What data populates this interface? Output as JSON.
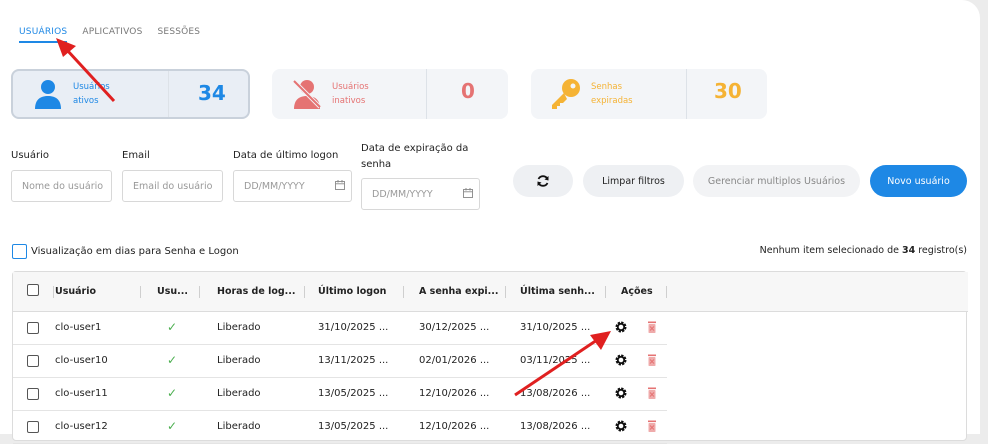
{
  "tabs": [
    {
      "label": "USUÁRIOS",
      "active": true
    },
    {
      "label": "APLICATIVOS",
      "active": false
    },
    {
      "label": "SESSÕES",
      "active": false
    }
  ],
  "cards": [
    {
      "label_line1": "Usuários",
      "label_line2": "ativos",
      "count": "34",
      "color": "#1e88e5",
      "icon": "user-icon"
    },
    {
      "label_line1": "Usuários",
      "label_line2": "inativos",
      "count": "0",
      "color": "#e57373",
      "icon": "user-off-icon"
    },
    {
      "label_line1": "Senhas",
      "label_line2": "expiradas",
      "count": "30",
      "color": "#f5b335",
      "icon": "key-icon"
    }
  ],
  "filters": {
    "user_label": "Usuário",
    "user_placeholder": "Nome do usuário",
    "email_label": "Email",
    "email_placeholder": "Email do usuário",
    "last_logon_label": "Data de último logon",
    "last_logon_placeholder": "DD/MM/YYYY",
    "expiry_label_line1": "Data de expiração da",
    "expiry_label_line2": "senha",
    "expiry_placeholder": "DD/MM/YYYY"
  },
  "buttons": {
    "clear": "Limpar filtros",
    "manage": "Gerenciar multiplos Usuários",
    "new_user": "Novo usuário"
  },
  "view_days_label": "Visualização em dias para Senha e Logon",
  "selection": {
    "prefix": "Nenhum item selecionado de ",
    "count": "34",
    "suffix": " registro(s)"
  },
  "table": {
    "headers": [
      "Usuário",
      "Usu...",
      "Horas de log...",
      "Último logon",
      "A senha expi...",
      "Última senh...",
      "Ações"
    ],
    "rows": [
      {
        "user": "clo-user1",
        "status": "✓",
        "hours": "Liberado",
        "last_logon": "31/10/2025 ...",
        "expires": "30/12/2025 ...",
        "last_change": "31/10/2025 ..."
      },
      {
        "user": "clo-user10",
        "status": "✓",
        "hours": "Liberado",
        "last_logon": "13/11/2025 ...",
        "expires": "02/01/2026 ...",
        "last_change": "03/11/2025 ..."
      },
      {
        "user": "clo-user11",
        "status": "✓",
        "hours": "Liberado",
        "last_logon": "13/05/2025 ...",
        "expires": "12/10/2026 ...",
        "last_change": "13/08/2026 ..."
      },
      {
        "user": "clo-user12",
        "status": "✓",
        "hours": "Liberado",
        "last_logon": "13/05/2025 ...",
        "expires": "12/10/2026 ...",
        "last_change": "13/08/2026 ..."
      }
    ]
  }
}
